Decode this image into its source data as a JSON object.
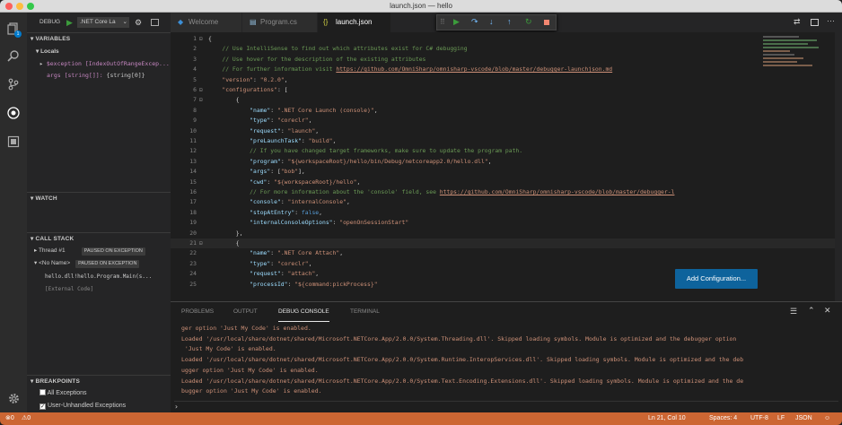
{
  "window": {
    "title": "launch.json — hello"
  },
  "sidebar": {
    "debug_label": "DEBUG",
    "config_name": ".NET Core La",
    "variables_header": "VARIABLES",
    "locals_label": "Locals",
    "var_exception": "$exception [IndexOutOfRangeExcep...",
    "var_args_name": "args [string[]]:",
    "var_args_value": "{string[0]}",
    "watch_header": "WATCH",
    "callstack_header": "CALL STACK",
    "thread_name": "Thread #1",
    "thread_status": "PAUSED ON EXCEPTION",
    "noname": "<No Name>",
    "noname_status": "PAUSED ON EXCEPTION",
    "frame1": "hello.dll!hello.Program.Main(s...",
    "frame2": "[External Code]",
    "breakpoints_header": "BREAKPOINTS",
    "bp_all": "All Exceptions",
    "bp_unhandled": "User-Unhandled Exceptions",
    "bp_all_checked": false,
    "bp_unhandled_checked": true
  },
  "activity": {
    "badge": "1"
  },
  "tabs": [
    {
      "label": "Welcome"
    },
    {
      "label": "Program.cs"
    },
    {
      "label": "launch.json"
    }
  ],
  "editor": {
    "line_numbers": [
      "1",
      "2",
      "3",
      "4",
      "5",
      "6",
      "7",
      "8",
      "9",
      "10",
      "11",
      "12",
      "13",
      "14",
      "15",
      "16",
      "17",
      "18",
      "19",
      "20",
      "21",
      "22",
      "23",
      "24",
      "25"
    ],
    "add_config_label": "Add Configuration..."
  },
  "panel": {
    "tabs": [
      "PROBLEMS",
      "OUTPUT",
      "DEBUG CONSOLE",
      "TERMINAL"
    ],
    "output_lines": [
      "ger option 'Just My Code' is enabled.",
      "Loaded '/usr/local/share/dotnet/shared/Microsoft.NETCore.App/2.0.0/System.Threading.dll'. Skipped loading symbols. Module is optimized and the debugger option",
      " 'Just My Code' is enabled.",
      "Loaded '/usr/local/share/dotnet/shared/Microsoft.NETCore.App/2.0.0/System.Runtime.InteropServices.dll'. Skipped loading symbols. Module is optimized and the deb",
      "ugger option 'Just My Code' is enabled.",
      "Loaded '/usr/local/share/dotnet/shared/Microsoft.NETCore.App/2.0.0/System.Text.Encoding.Extensions.dll'. Skipped loading symbols. Module is optimized and the de",
      "bugger option 'Just My Code' is enabled."
    ],
    "prompt": "›"
  },
  "status": {
    "errors": "0",
    "warnings": "0",
    "position": "Ln 21, Col 10",
    "spaces": "Spaces: 4",
    "encoding": "UTF-8",
    "eol": "LF",
    "language": "JSON",
    "bar_color": "#cc6633"
  }
}
